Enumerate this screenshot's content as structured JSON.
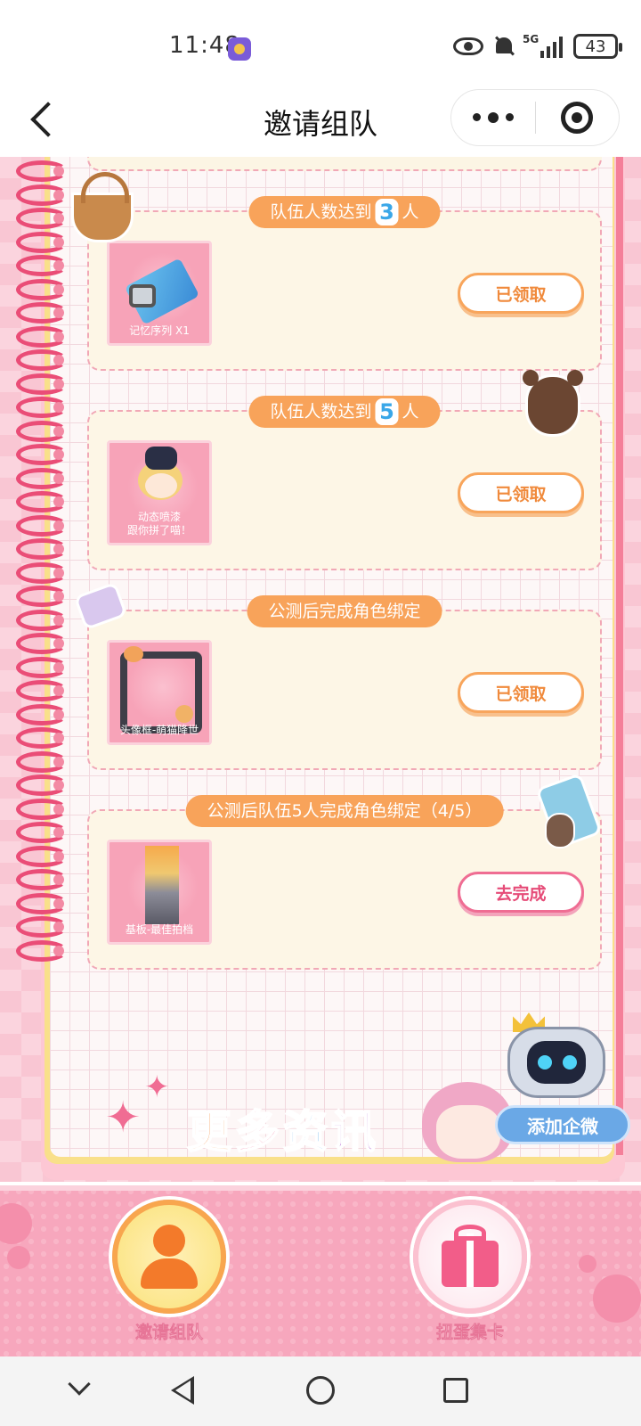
{
  "status_bar": {
    "time": "11:48",
    "network": "5G",
    "battery": "43"
  },
  "nav": {
    "title": "邀请组队"
  },
  "tasks": [
    {
      "title_prefix": "队伍人数达到",
      "title_number": "3",
      "title_suffix": "人",
      "reward_label": "记忆序列 X1",
      "button": "已领取",
      "status": "claimed"
    },
    {
      "title_prefix": "队伍人数达到",
      "title_number": "5",
      "title_suffix": "人",
      "reward_label": "动态喷漆\n跟你拼了喵！",
      "button": "已领取",
      "status": "claimed"
    },
    {
      "title": "公测后完成角色绑定",
      "reward_label": "头像框-萌猫降世",
      "button": "已领取",
      "status": "claimed"
    },
    {
      "title": "公测后队伍5人完成角色绑定（4/5）",
      "reward_label": "基板-最佳拍档",
      "button": "去完成",
      "status": "todo"
    }
  ],
  "banner": {
    "text": "更多资讯",
    "wechat_button": "添加企微"
  },
  "tabs": [
    {
      "label": "邀请组队",
      "icon": "team-icon",
      "active": true
    },
    {
      "label": "扭蛋集卡",
      "icon": "gift-icon",
      "active": false
    }
  ],
  "colors": {
    "accent_orange": "#f8a35a",
    "accent_pink": "#ef6d93",
    "background_pink": "#fbd4de"
  }
}
